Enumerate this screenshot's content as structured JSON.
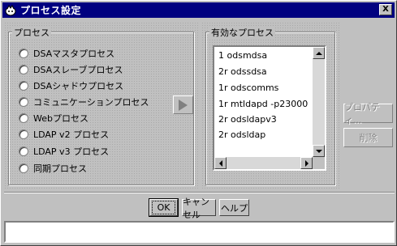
{
  "window": {
    "title": "プロセス設定",
    "close_label": "X"
  },
  "process_group": {
    "label": "プロセス",
    "options": [
      "DSAマスタプロセス",
      "DSAスレーブプロセス",
      "DSAシャドウプロセス",
      "コミュニケーションプロセス",
      "Webプロセス",
      "LDAP v2 プロセス",
      "LDAP v3 プロセス",
      "同期プロセス"
    ]
  },
  "active_group": {
    "label": "有効なプロセス",
    "items": [
      "1 odsmdsa",
      "2r odssdsa",
      "1r odscomms",
      "1r mtldapd -p23000",
      "2r odsldapv3",
      "2r odsldap"
    ]
  },
  "side_buttons": {
    "properties": "プロパティ...",
    "delete": "削除"
  },
  "footer": {
    "ok": "OK",
    "cancel": "キャンセル",
    "help": "ヘルプ",
    "status": ""
  },
  "colors": {
    "titlebar": "#000080",
    "face": "#c0c0c0",
    "disabled_text": "#808080"
  }
}
